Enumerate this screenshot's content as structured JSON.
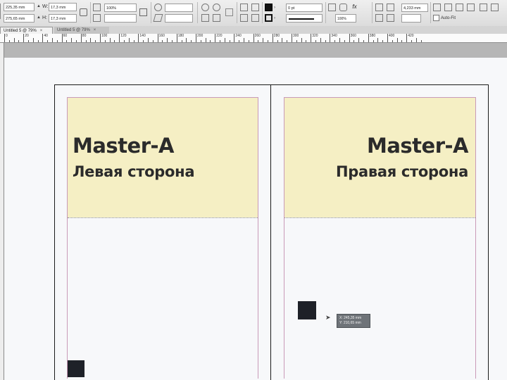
{
  "control_bar": {
    "x_value": "225,35 mm",
    "y_value": "275,65 mm",
    "w_label": "W:",
    "w_value": "17,3 mm",
    "h_label": "H:",
    "h_value": "17,3 mm",
    "scale_x_value": "100%",
    "stroke_weight_value": "0 pt",
    "opacity_value": "100%",
    "dimension_value": "4,233 mm",
    "auto_fit_label": "Auto-Fit"
  },
  "tabs": [
    {
      "label": "Untitled 5 @ 79%",
      "close": "×"
    },
    {
      "label": "Untitled 5 @ 79%",
      "close": "×"
    }
  ],
  "ruler": {
    "labels": [
      "0",
      "20",
      "40",
      "60",
      "80",
      "100",
      "120",
      "140",
      "160",
      "180",
      "200",
      "220",
      "240",
      "260",
      "280",
      "300",
      "320",
      "340",
      "360",
      "380",
      "400",
      "420"
    ]
  },
  "spread": {
    "left_page": {
      "title": "Master-A",
      "subtitle": "Левая сторона"
    },
    "right_page": {
      "title": "Master-A",
      "subtitle": "Правая сторона"
    }
  },
  "cursor_tooltip": {
    "x_line": "X: 245,35 mm",
    "y_line": "Y: 210,65 mm"
  },
  "colors": {
    "header_fill": "#f5efc4",
    "margin_guide": "#c99ab8",
    "square_fill": "#1e2128"
  },
  "icons": [
    "reference-point-icon",
    "constrain-proportions-icon",
    "rotate-icon",
    "shear-icon",
    "flip-horizontal-icon",
    "flip-vertical-icon",
    "select-container-icon",
    "fill-swatch-icon",
    "stroke-swatch-icon",
    "fx-icon",
    "drop-shadow-icon",
    "fitting-icon"
  ]
}
